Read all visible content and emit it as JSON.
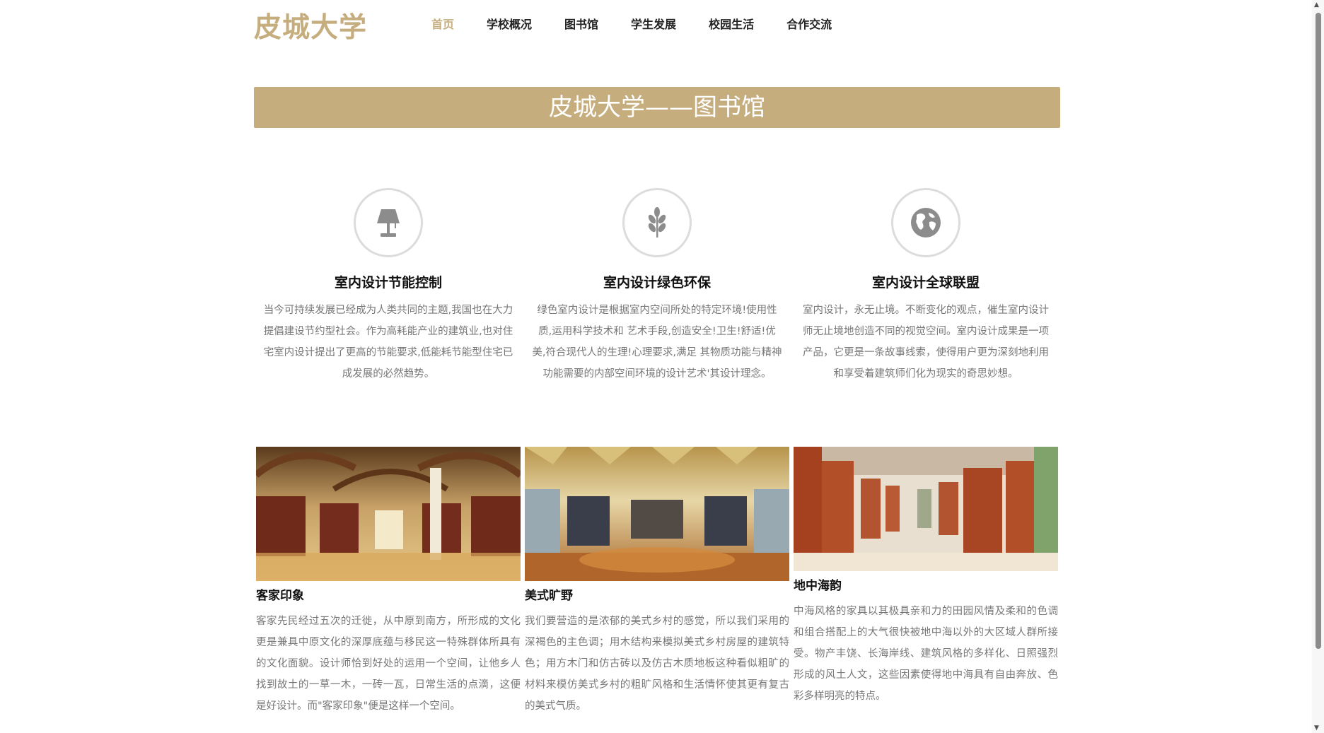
{
  "brand": {
    "logo": "皮城大学"
  },
  "nav": {
    "items": [
      {
        "label": "首页",
        "active": true
      },
      {
        "label": "学校概况"
      },
      {
        "label": "图书馆"
      },
      {
        "label": "学生发展"
      },
      {
        "label": "校园生活"
      },
      {
        "label": "合作交流"
      }
    ]
  },
  "banner": {
    "title": "皮城大学——图书馆"
  },
  "features": [
    {
      "icon": "lamp-icon",
      "title": "室内设计节能控制",
      "text": "当今可持续发展已经成为人类共同的主题,我国也在大力提倡建设节约型社会。作为高耗能产业的建筑业,也对住宅室内设计提出了更高的节能要求,低能耗节能型住宅已成发展的必然趋势。"
    },
    {
      "icon": "wheat-icon",
      "title": "室内设计绿色环保",
      "text": "绿色室内设计是根据室内空间所处的特定环境!使用性质,运用科学技术和 艺术手段,创造安全!卫生!舒适!优美,符合现代人的生理!心理要求,满足 其物质功能与精神功能需要的内部空间环境的设计艺术'其设计理念。"
    },
    {
      "icon": "globe-icon",
      "title": "室内设计全球联盟",
      "text": "室内设计，永无止境。不断变化的观点，催生室内设计师无止境地创造不同的视觉空间。室内设计成果是一项产品，它更是一条故事线索，使得用户更为深刻地利用和享受着建筑师们化为现实的奇思妙想。"
    }
  ],
  "cards": [
    {
      "title": "客家印象",
      "text": "客家先民经过五次的迁徙，从中原到南方，所形成的文化更是兼具中原文化的深厚底蕴与移民这一特殊群体所具有的文化面貌。设计师恰到好处的运用一个空间，让他乡人找到故土的一草一木，一砖一瓦，日常生活的点滴，这便是好设计。而\"客家印象\"便是这样一个空间。"
    },
    {
      "title": "美式旷野",
      "text": "我们要营造的是浓郁的美式乡村的感觉，所以我们采用的深褐色的主色调；用木结构来模拟美式乡村房屋的建筑特色；用方木门和仿古砖以及仿古木质地板这种看似粗旷的材料来模仿美式乡村的粗旷风格和生活情怀使其更有复古的美式气质。"
    },
    {
      "title": "地中海韵",
      "text": "中海风格的家具以其极具亲和力的田园风情及柔和的色调和组合搭配上的大气很快被地中海以外的大区域人群所接受。物产丰饶、长海岸线、建筑风格的多样化、日照强烈形成的风土人文，这些因素使得地中海具有自由奔放、色彩多样明亮的特点。"
    }
  ],
  "colors": {
    "accent": "#c5ad7e",
    "text_muted": "#777777",
    "heading": "#111111"
  }
}
